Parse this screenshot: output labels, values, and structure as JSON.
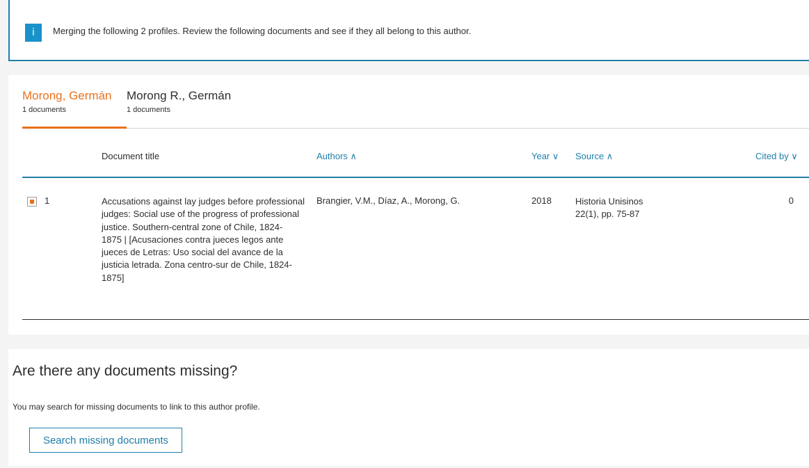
{
  "info": {
    "icon": "info-icon",
    "icon_glyph": "i",
    "message": "Merging the following 2 profiles. Review the following documents and see if they all belong to this author."
  },
  "profiles": [
    {
      "name": "Morong, Germán",
      "count": "1 documents",
      "active": true
    },
    {
      "name": "Morong R., Germán",
      "count": "1 documents",
      "active": false
    }
  ],
  "table": {
    "headers": {
      "title": "Document title",
      "authors": "Authors ∧",
      "year": "Year ∨",
      "source": "Source ∧",
      "cited_by": "Cited by ∨"
    },
    "rows": [
      {
        "checked": true,
        "number": "1",
        "title": "Accusations against lay judges before professional judges: Social use of the progress of professional justice. Southern-central zone of Chile, 1824-1875 | [Acusaciones contra jueces legos ante jueces de Letras: Uso social del avance de la justicia letrada. Zona centro-sur de Chile, 1824-1875]",
        "title_lines": [
          "Accusations against lay judges before professional",
          "judges: Social use of the progress of professional",
          "justice. Southern-central zone of Chile, 1824-",
          "1875 | [Acusaciones contra jueces legos ante",
          "jueces de Letras: Uso social del avance de la",
          "justicia letrada. Zona centro-sur de Chile, 1824-",
          "1875]"
        ],
        "authors": "Brangier, V.M., Díaz, A., Morong, G.",
        "year": "2018",
        "source_name": "Historia Unisinos",
        "source_detail": "22(1), pp. 75-87",
        "cited_by": "0"
      }
    ]
  },
  "missing": {
    "heading": "Are there any documents missing?",
    "description": "You may search for missing documents to link to this author profile.",
    "button_label": "Search missing documents"
  },
  "colors": {
    "accent_orange": "#e9711c",
    "link_blue": "#1f7fa8",
    "info_blue": "#1992c9"
  }
}
